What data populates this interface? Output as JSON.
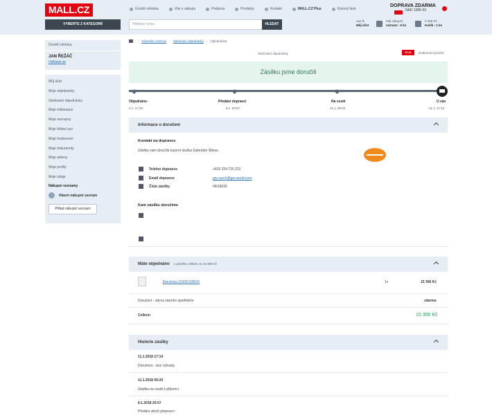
{
  "header": {
    "logo": "MALL.CZ",
    "links": [
      "Úvodní stránka",
      "Vše o nákupu",
      "Podpora",
      "Prodejny",
      "Kontakt",
      "MALL.CZ Plus",
      "Kávový klub"
    ],
    "promo_title": "DOPRAVA ZDARMA",
    "promo_sub": "NAD 1000 Kč",
    "categories_button": "VYBERTE Z KATEGORIÍ",
    "search_placeholder": "Hledaný výraz...",
    "search_button": "HLEDAT",
    "account_line1": "Jan Ř.",
    "account_line2": "Můj účet",
    "wishlist_line1": "Můj nákupní",
    "wishlist_line2": "seznam : 6 ks",
    "cart_line1": "0.368 Kč",
    "cart_line2": "Košík : 1 ks"
  },
  "sidebar": {
    "home_link": "Úvodní stránka",
    "user_name": "JAN ŘEŽÁČ",
    "logout": "Odhlásit se",
    "items": [
      "Můj účet",
      "Moje objednávky",
      "Sledování objednávky",
      "Moje reklamace",
      "Moje seznamy",
      "Moje hlídací psi",
      "Moje hodnocení",
      "Moje dokumenty",
      "Moje adresy",
      "Moje profily",
      "Moje údaje"
    ],
    "lists_heading": "Nákupní seznamy",
    "main_list": "Hlavní nákupní seznam",
    "add_list_button": "Přidat nákupní seznam"
  },
  "breadcrumb": [
    "Klientské centrum",
    "Sledování objednávky",
    "Objednávka"
  ],
  "status_header": "Sledování objednávky",
  "badge": "ELIA",
  "badge_text": "Hodnocení prosím",
  "delivered_title": "Zásilku jsme doručili",
  "steps": [
    {
      "label": "Objednáno",
      "date": "4.1. 17:49"
    },
    {
      "label": "Předání dopravci",
      "date": "8.1. 20:57"
    },
    {
      "label": "Na cestě",
      "date": "11.1. 09:24"
    },
    {
      "label": "U vás",
      "date": "11.1. 17:14"
    }
  ],
  "delivery_info": {
    "title": "Informace o doručení",
    "contact_heading": "Kontakt na dopravce",
    "contact_text": "Zásilku vám doručila kurýrní služba Gebrüder Weiss.",
    "rows": [
      {
        "label": "Telefon dopravce",
        "value": "+420 224 725 222"
      },
      {
        "label": "Email dopravce",
        "value": "gw.czech@gw-world.com"
      },
      {
        "label": "Číslo zásilky",
        "value": "49/18035"
      }
    ],
    "where_heading": "Kam zásilku doručíme"
  },
  "order": {
    "title": "Máte objednáno",
    "subtitle": "1 položku celkem za 15 306 Kč",
    "item_name": "Electrolux ESI5510ROX",
    "item_qty": "1x",
    "item_price": "15 306 Kč",
    "shipping_label": "Doručení - odvoz starého spotřebiče",
    "shipping_value": "zdarma",
    "total_label": "Celkem",
    "total_value": "15 306 Kč"
  },
  "history": {
    "title": "Historie zásilky",
    "entries": [
      {
        "time": "11.1.2018 17:14",
        "text": "Doručeno - bez výhrady"
      },
      {
        "time": "11.1.2018 09:24",
        "text": "Zásilka na cestě k příjemci"
      },
      {
        "time": "8.1.2018 20:57",
        "text": "Předání zboží přepravci"
      }
    ]
  }
}
